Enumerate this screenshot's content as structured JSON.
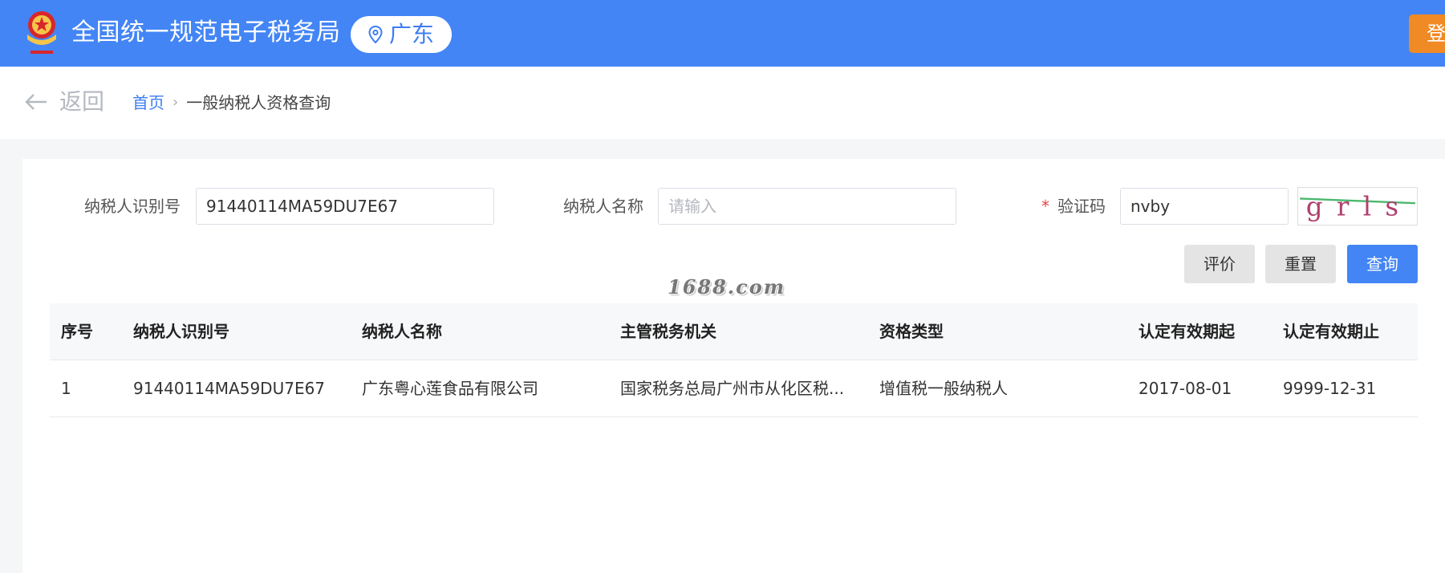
{
  "header": {
    "title": "全国统一规范电子税务局",
    "region": "广东",
    "login_label": "登",
    "emblem_icon": "tax-emblem-icon",
    "brand_color": "#4385f5",
    "login_color": "#f08a24"
  },
  "nav": {
    "back_label": "返回",
    "breadcrumb": {
      "home": "首页",
      "separator": "›",
      "current": "一般纳税人资格查询"
    }
  },
  "form": {
    "taxpayer_id": {
      "label": "纳税人识别号",
      "value": "91440114MA59DU7E67"
    },
    "taxpayer_name": {
      "label": "纳税人名称",
      "value": "",
      "placeholder": "请输入"
    },
    "captcha": {
      "required_mark": "*",
      "label": "验证码",
      "value": "nvby",
      "image_text": "grls"
    },
    "buttons": {
      "evaluate": "评价",
      "reset": "重置",
      "query": "查询"
    }
  },
  "watermark": "1688.com",
  "table": {
    "columns": [
      "序号",
      "纳税人识别号",
      "纳税人名称",
      "主管税务机关",
      "资格类型",
      "认定有效期起",
      "认定有效期止"
    ],
    "rows": [
      [
        "1",
        "91440114MA59DU7E67",
        "广东粤心莲食品有限公司",
        "国家税务总局广州市从化区税...",
        "增值税一般纳税人",
        "2017-08-01",
        "9999-12-31"
      ]
    ]
  }
}
